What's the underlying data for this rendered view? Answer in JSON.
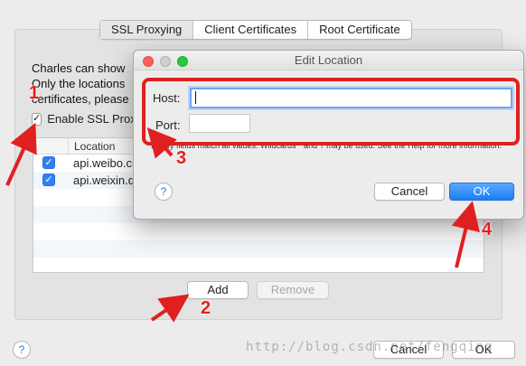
{
  "tabs": [
    "SSL Proxying",
    "Client Certificates",
    "Root Certificate"
  ],
  "description_lines": [
    "Charles can show",
    "Only the locations",
    "certificates, please"
  ],
  "enable_ssl_label": "Enable SSL Proxying",
  "list": {
    "column_header": "Location",
    "rows": [
      {
        "location": "api.weibo.cn",
        "checked": true
      },
      {
        "location": "api.weixin.qq.com",
        "checked": true
      }
    ]
  },
  "buttons": {
    "add": "Add",
    "remove": "Remove",
    "cancel": "Cancel",
    "ok": "OK",
    "help": "?"
  },
  "dialog": {
    "title": "Edit Location",
    "host_label": "Host:",
    "host_value": "",
    "port_label": "Port:",
    "port_value": "",
    "hint": "Empty fields match all values. Wildcards * and ? may be used. See the Help for more information.",
    "cancel": "Cancel",
    "ok": "OK",
    "help": "?"
  },
  "annotations": [
    "1",
    "2",
    "3",
    "4"
  ],
  "annotation_color": "#e02020",
  "accent_color": "#1c7cf4",
  "watermark": "http://blog.csdn.net/fengqing"
}
